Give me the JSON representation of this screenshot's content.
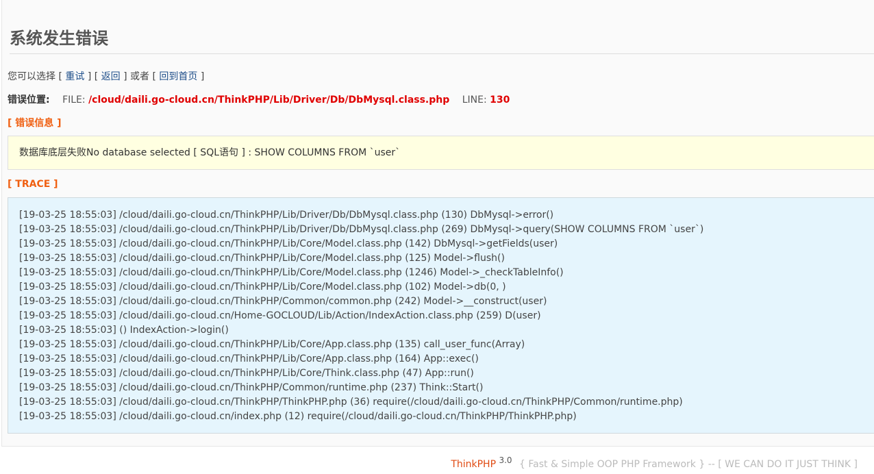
{
  "page": {
    "title": "系统发生错误",
    "choose": {
      "prefix": "您可以选择",
      "open_bracket": "[",
      "close_bracket": "]",
      "retry_label": "重试",
      "back_label": "返回",
      "or_label": "或者",
      "home_label": "回到首页"
    },
    "location": {
      "label": "错误位置:",
      "file_label": "FILE:",
      "file_value": "/cloud/daili.go-cloud.cn/ThinkPHP/Lib/Driver/Db/DbMysql.class.php",
      "line_label": "LINE:",
      "line_value": "130"
    },
    "error_section": {
      "heading": "[ 错误信息 ]",
      "message": "数据库底层失败No database selected [ SQL语句 ] : SHOW COLUMNS FROM `user`"
    },
    "trace_section": {
      "heading": "[ TRACE ]",
      "lines": [
        "[19-03-25 18:55:03] /cloud/daili.go-cloud.cn/ThinkPHP/Lib/Driver/Db/DbMysql.class.php (130) DbMysql->error()",
        "[19-03-25 18:55:03] /cloud/daili.go-cloud.cn/ThinkPHP/Lib/Driver/Db/DbMysql.class.php (269) DbMysql->query(SHOW COLUMNS FROM `user`)",
        "[19-03-25 18:55:03] /cloud/daili.go-cloud.cn/ThinkPHP/Lib/Core/Model.class.php (142) DbMysql->getFields(user)",
        "[19-03-25 18:55:03] /cloud/daili.go-cloud.cn/ThinkPHP/Lib/Core/Model.class.php (125) Model->flush()",
        "[19-03-25 18:55:03] /cloud/daili.go-cloud.cn/ThinkPHP/Lib/Core/Model.class.php (1246) Model->_checkTableInfo()",
        "[19-03-25 18:55:03] /cloud/daili.go-cloud.cn/ThinkPHP/Lib/Core/Model.class.php (102) Model->db(0, )",
        "[19-03-25 18:55:03] /cloud/daili.go-cloud.cn/ThinkPHP/Common/common.php (242) Model->__construct(user)",
        "[19-03-25 18:55:03] /cloud/daili.go-cloud.cn/Home-GOCLOUD/Lib/Action/IndexAction.class.php (259) D(user)",
        "[19-03-25 18:55:03] () IndexAction->login()",
        "[19-03-25 18:55:03] /cloud/daili.go-cloud.cn/ThinkPHP/Lib/Core/App.class.php (135) call_user_func(Array)",
        "[19-03-25 18:55:03] /cloud/daili.go-cloud.cn/ThinkPHP/Lib/Core/App.class.php (164) App::exec()",
        "[19-03-25 18:55:03] /cloud/daili.go-cloud.cn/ThinkPHP/Lib/Core/Think.class.php (47) App::run()",
        "[19-03-25 18:55:03] /cloud/daili.go-cloud.cn/ThinkPHP/Common/runtime.php (237) Think::Start()",
        "[19-03-25 18:55:03] /cloud/daili.go-cloud.cn/ThinkPHP/ThinkPHP.php (36) require(/cloud/daili.go-cloud.cn/ThinkPHP/Common/runtime.php)",
        "[19-03-25 18:55:03] /cloud/daili.go-cloud.cn/index.php (12) require(/cloud/daili.go-cloud.cn/ThinkPHP/ThinkPHP.php)"
      ]
    },
    "footer": {
      "brand": "ThinkPHP",
      "version": "3.0",
      "tagline": "{ Fast & Simple OOP PHP Framework } -- [ WE CAN DO IT JUST THINK ]"
    }
  },
  "colors": {
    "error_red": "#e00000",
    "section_orange": "#f06012",
    "link_blue": "#1f4f8a",
    "message_bg": "#ffffe1",
    "trace_bg": "#e5f5fd"
  }
}
